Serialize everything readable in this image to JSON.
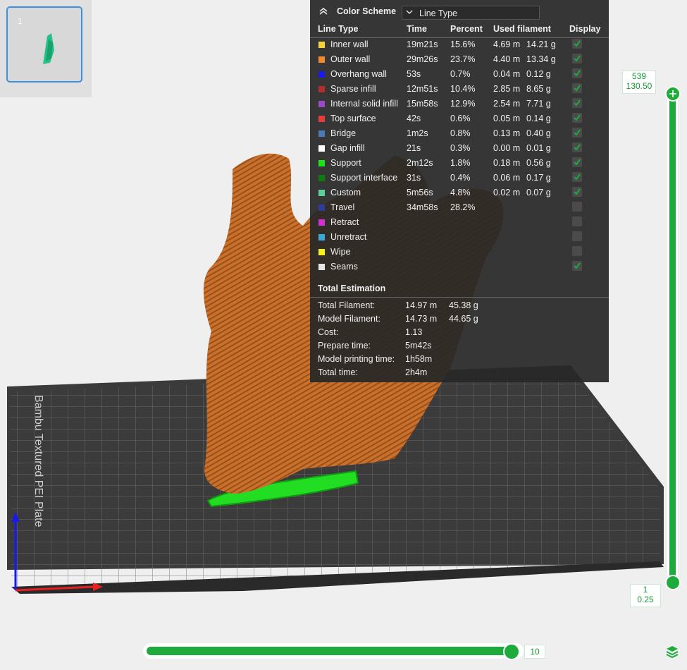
{
  "thumbnail": {
    "plate_number": "1"
  },
  "legend": {
    "title": "Color Scheme",
    "scheme_selected": "Line Type",
    "columns": [
      "Line Type",
      "Time",
      "Percent",
      "Used filament",
      "Display"
    ],
    "rows": [
      {
        "name": "Inner wall",
        "color": "#f5d33a",
        "time": "19m21s",
        "percent": "15.6%",
        "length": "4.69 m",
        "weight": "14.21 g",
        "display": true
      },
      {
        "name": "Outer wall",
        "color": "#f28a32",
        "time": "29m26s",
        "percent": "23.7%",
        "length": "4.40 m",
        "weight": "13.34 g",
        "display": true
      },
      {
        "name": "Overhang wall",
        "color": "#1a1aef",
        "time": "53s",
        "percent": "0.7%",
        "length": "0.04 m",
        "weight": "0.12 g",
        "display": true
      },
      {
        "name": "Sparse infill",
        "color": "#b02e2e",
        "time": "12m51s",
        "percent": "10.4%",
        "length": "2.85 m",
        "weight": "8.65 g",
        "display": true
      },
      {
        "name": "Internal solid infill",
        "color": "#9a4ac4",
        "time": "15m58s",
        "percent": "12.9%",
        "length": "2.54 m",
        "weight": "7.71 g",
        "display": true
      },
      {
        "name": "Top surface",
        "color": "#e83c3c",
        "time": "42s",
        "percent": "0.6%",
        "length": "0.05 m",
        "weight": "0.14 g",
        "display": true
      },
      {
        "name": "Bridge",
        "color": "#4c7ab8",
        "time": "1m2s",
        "percent": "0.8%",
        "length": "0.13 m",
        "weight": "0.40 g",
        "display": true
      },
      {
        "name": "Gap infill",
        "color": "#ffffff",
        "time": "21s",
        "percent": "0.3%",
        "length": "0.00 m",
        "weight": "0.01 g",
        "display": true
      },
      {
        "name": "Support",
        "color": "#19e619",
        "time": "2m12s",
        "percent": "1.8%",
        "length": "0.18 m",
        "weight": "0.56 g",
        "display": true
      },
      {
        "name": "Support interface",
        "color": "#0d7a12",
        "time": "31s",
        "percent": "0.4%",
        "length": "0.06 m",
        "weight": "0.17 g",
        "display": true
      },
      {
        "name": "Custom",
        "color": "#5ecf9a",
        "time": "5m56s",
        "percent": "4.8%",
        "length": "0.02 m",
        "weight": "0.07 g",
        "display": true
      },
      {
        "name": "Travel",
        "color": "#2d3a9e",
        "time": "34m58s",
        "percent": "28.2%",
        "length": "",
        "weight": "",
        "display": false
      },
      {
        "name": "Retract",
        "color": "#d42fd4",
        "time": "",
        "percent": "",
        "length": "",
        "weight": "",
        "display": false
      },
      {
        "name": "Unretract",
        "color": "#3aa8d8",
        "time": "",
        "percent": "",
        "length": "",
        "weight": "",
        "display": false
      },
      {
        "name": "Wipe",
        "color": "#f5f01a",
        "time": "",
        "percent": "",
        "length": "",
        "weight": "",
        "display": false
      },
      {
        "name": "Seams",
        "color": "#e6e6e6",
        "time": "",
        "percent": "",
        "length": "",
        "weight": "",
        "display": true
      }
    ],
    "total": {
      "title": "Total Estimation",
      "rows": [
        {
          "label": "Total Filament:",
          "v1": "14.97 m",
          "v2": "45.38 g"
        },
        {
          "label": "Model Filament:",
          "v1": "14.73 m",
          "v2": "44.65 g"
        },
        {
          "label": "Cost:",
          "v1": "1.13",
          "v2": ""
        },
        {
          "label": "Prepare time:",
          "v1": "5m42s",
          "v2": ""
        },
        {
          "label": "Model printing time:",
          "v1": "1h58m",
          "v2": ""
        },
        {
          "label": "Total time:",
          "v1": "2h4m",
          "v2": ""
        }
      ]
    }
  },
  "layer_slider": {
    "top_layer": "539",
    "top_height": "130.50",
    "bottom_layer": "1",
    "bottom_height": "0.25"
  },
  "move_slider": {
    "value": "10"
  },
  "plate_text": "Bambu Textured PEI Plate",
  "colors": {
    "accent": "#1faa3c",
    "panel_bg": "#282828",
    "model": "#c8712c"
  }
}
